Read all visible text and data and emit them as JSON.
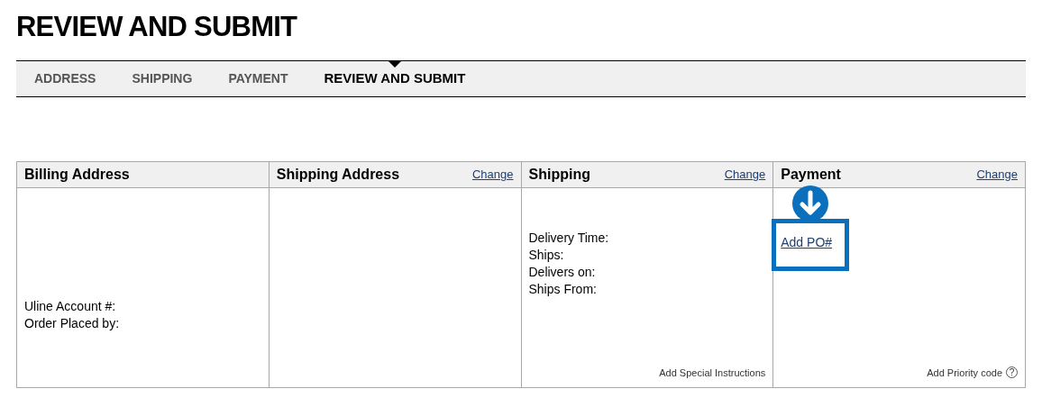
{
  "title": "REVIEW AND SUBMIT",
  "steps": [
    {
      "label": "ADDRESS",
      "selected": false
    },
    {
      "label": "SHIPPING",
      "selected": false
    },
    {
      "label": "PAYMENT",
      "selected": false
    },
    {
      "label": "REVIEW AND SUBMIT",
      "selected": true
    }
  ],
  "panels": [
    {
      "title": "Billing Address",
      "lines": [
        "Uline Account #:",
        "Order Placed by:"
      ]
    },
    {
      "title": "Shipping Address",
      "change": "Change"
    },
    {
      "title": "Shipping",
      "change": "Change",
      "lines": [
        "Delivery Time:",
        "Ships:",
        "Delivers on:",
        "Ships From:"
      ],
      "footer": "Add Special Instructions"
    },
    {
      "title": "Payment",
      "change": "Change",
      "link": "Add PO#",
      "highlighted": true,
      "footer": "Add Priority code",
      "help": "?"
    }
  ]
}
